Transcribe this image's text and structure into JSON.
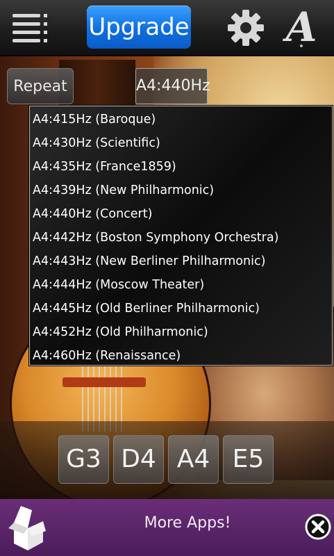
{
  "topbar": {
    "upgrade_label": "Upgrade",
    "font_icon_glyph": "A",
    "icons": [
      "menu-list-icon",
      "gear-icon",
      "font-style-icon"
    ]
  },
  "controls": {
    "repeat_label": "Repeat",
    "frequency_selected": "A4:440Hz"
  },
  "dropdown": {
    "options": [
      "A4:415Hz (Baroque)",
      "A4:430Hz (Scientific)",
      "A4:435Hz (France1859)",
      "A4:439Hz (New Philharmonic)",
      "A4:440Hz (Concert)",
      "A4:442Hz (Boston Symphony Orchestra)",
      "A4:443Hz (New Berliner Philharmonic)",
      "A4:444Hz (Moscow Theater)",
      "A4:445Hz (Old Berliner Philharmonic)",
      "A4:452Hz (Old Philharmonic)",
      "A4:460Hz (Renaissance)"
    ]
  },
  "notes": [
    "G3",
    "D4",
    "A4",
    "E5"
  ],
  "ad": {
    "text": "More Apps!",
    "icons": [
      "open-box-icon",
      "close-icon"
    ]
  },
  "colors": {
    "upgrade_blue": "#1a7ff0",
    "ad_purple": "#5a2468",
    "topbar_dark": "#1c1c1c"
  }
}
